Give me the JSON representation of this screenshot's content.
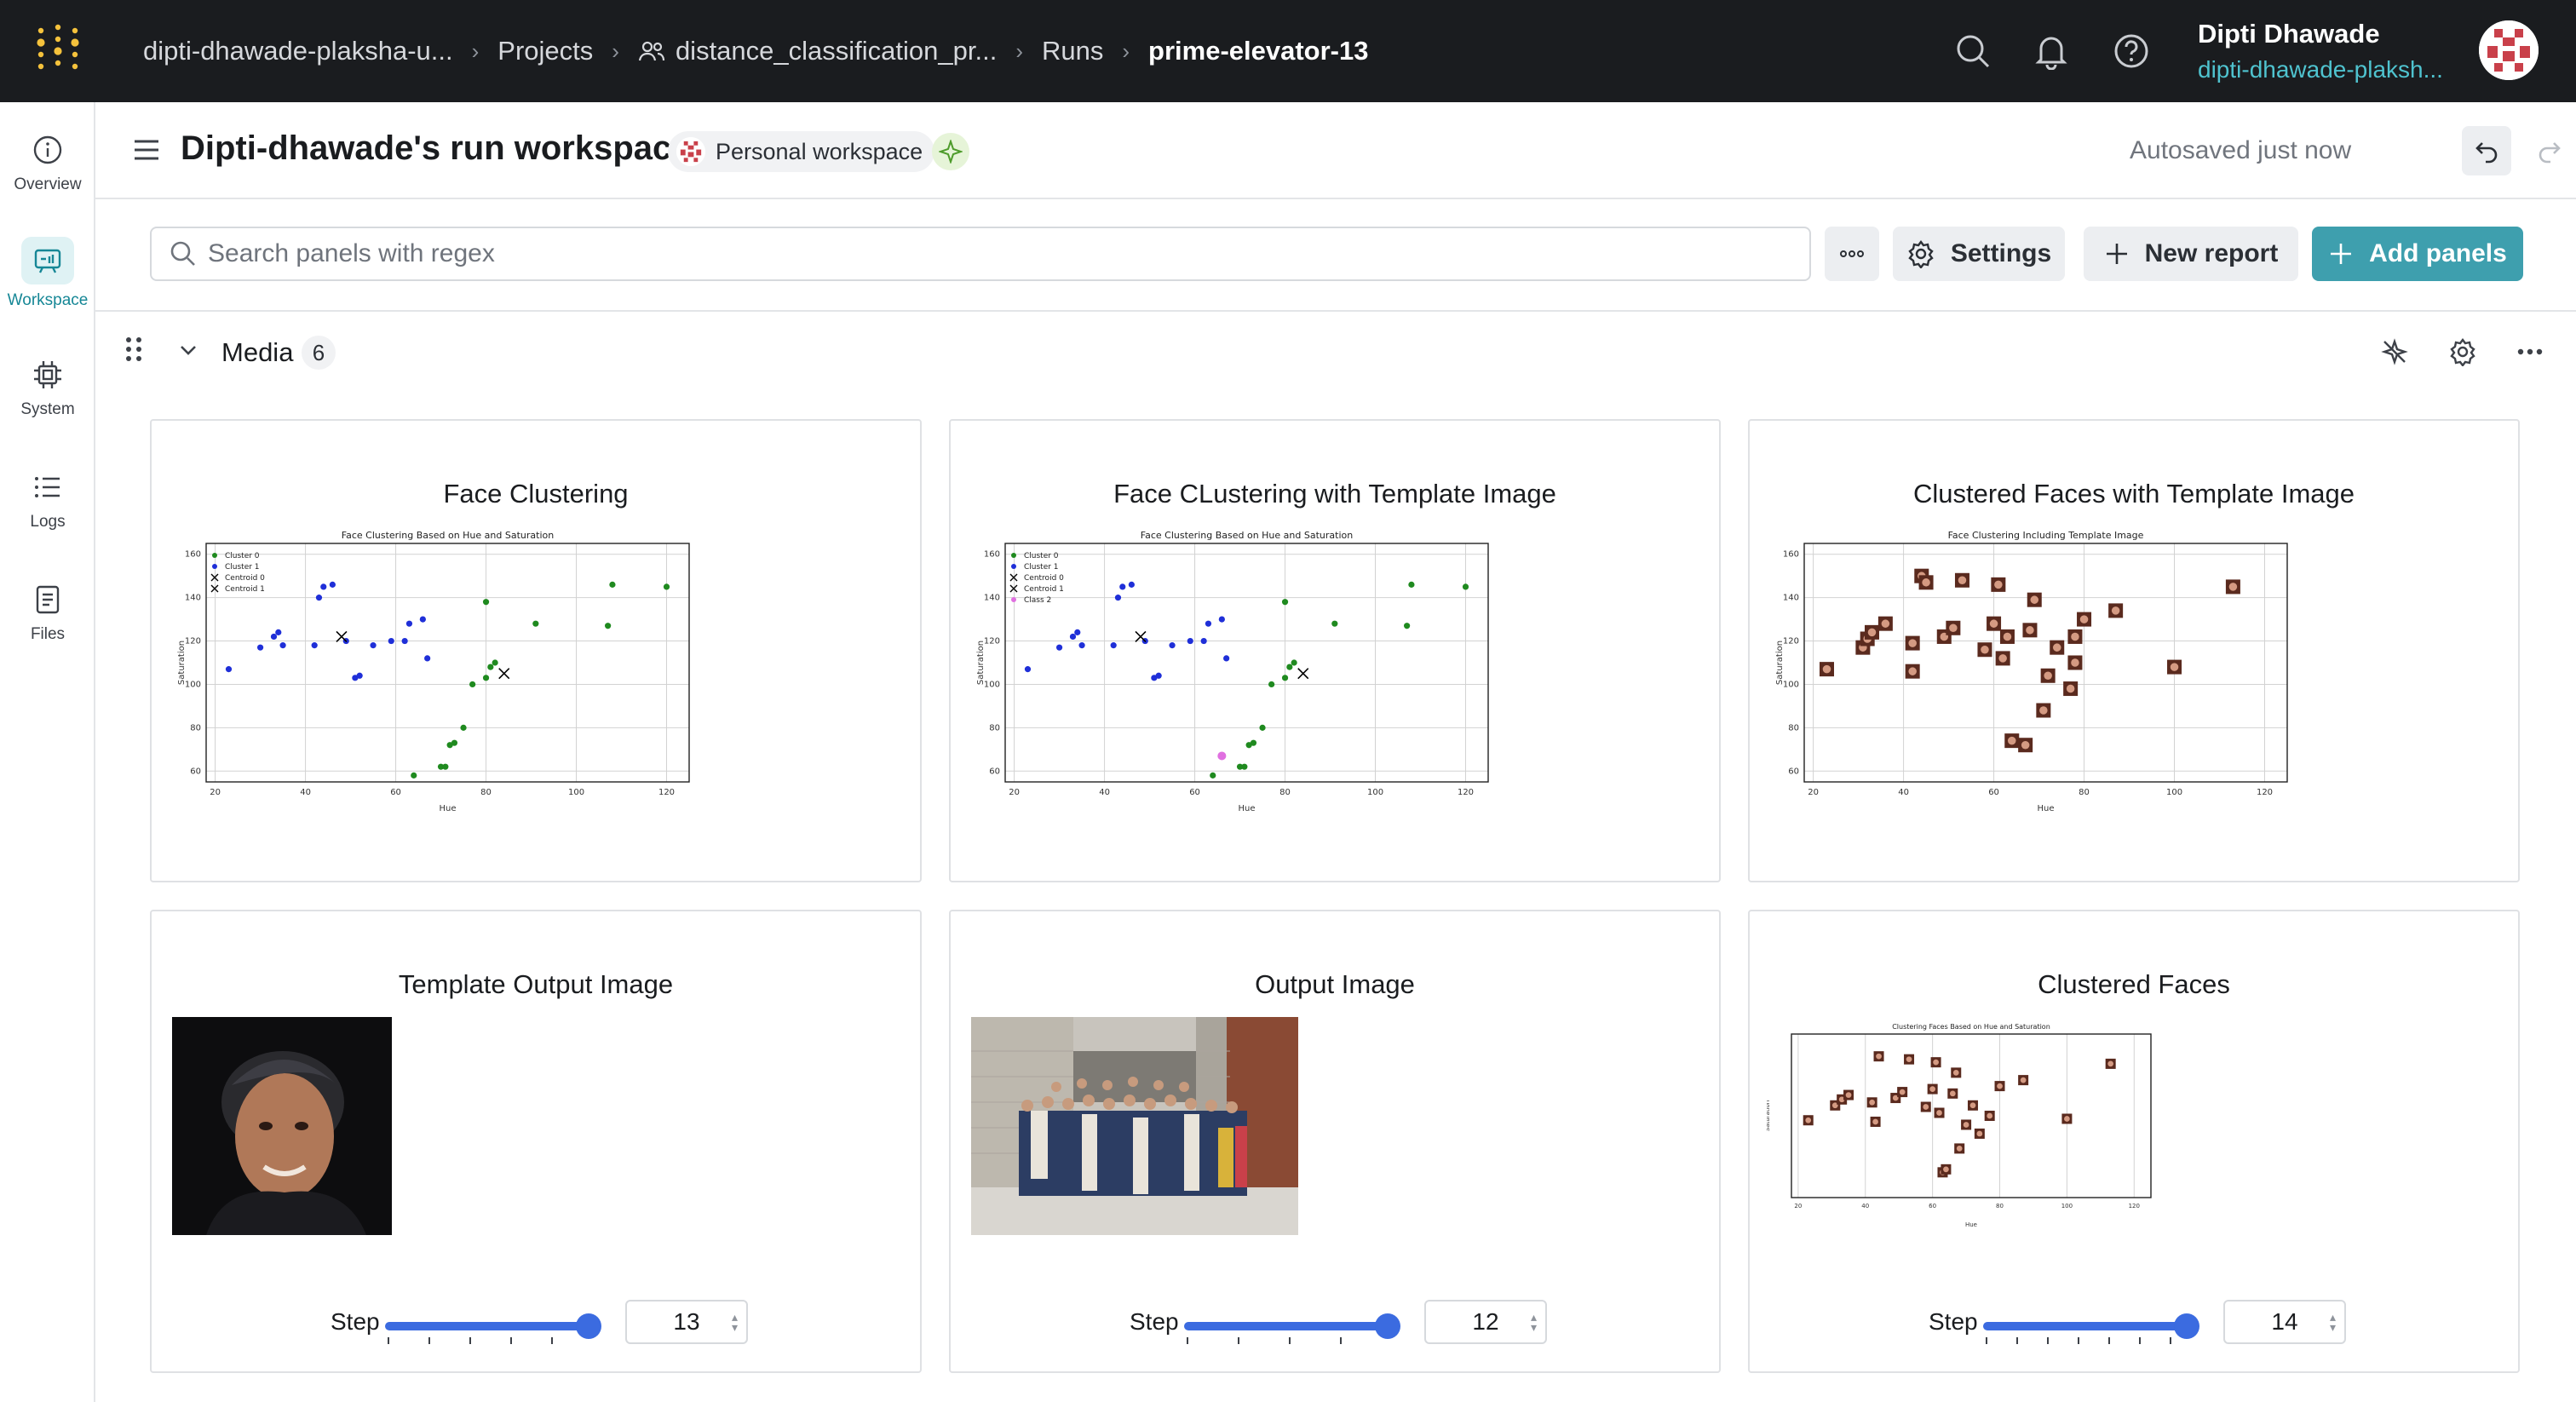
{
  "topbar": {
    "breadcrumbs": [
      "dipti-dhawade-plaksha-u...",
      "Projects",
      "distance_classification_pr...",
      "Runs",
      "prime-elevator-13"
    ],
    "user_name": "Dipti Dhawade",
    "user_org": "dipti-dhawade-plaksh..."
  },
  "leftnav": {
    "items": [
      {
        "label": "Overview",
        "icon": "info-icon"
      },
      {
        "label": "Workspace",
        "icon": "workspace-icon",
        "active": true
      },
      {
        "label": "System",
        "icon": "chip-icon"
      },
      {
        "label": "Logs",
        "icon": "list-icon"
      },
      {
        "label": "Files",
        "icon": "file-icon"
      }
    ]
  },
  "header": {
    "title": "Dipti-dhawade's run workspace",
    "workspace_badge": "Personal workspace",
    "autosaved": "Autosaved just now"
  },
  "toolbar": {
    "search_placeholder": "Search panels with regex",
    "settings_label": "Settings",
    "new_report_label": "New report",
    "add_panels_label": "Add panels"
  },
  "section": {
    "title": "Media",
    "count": "6"
  },
  "panels": [
    {
      "title": "Face Clustering",
      "chart_title": "Face Clustering Based on Hue and Saturation"
    },
    {
      "title": "Face CLustering with Template Image",
      "chart_title": "Face Clustering Based on Hue and Saturation"
    },
    {
      "title": "Clustered Faces with Template Image",
      "chart_title": "Face Clustering Including Template Image"
    },
    {
      "title": "Template Output Image",
      "step_label": "Step",
      "step_value": "13"
    },
    {
      "title": "Output Image",
      "step_label": "Step",
      "step_value": "12"
    },
    {
      "title": "Clustered Faces",
      "step_label": "Step",
      "step_value": "14",
      "chart_title": "Clustering Faces Based on Hue and Saturation"
    }
  ],
  "chart_data": [
    {
      "type": "scatter",
      "title": "Face Clustering Based on Hue and Saturation",
      "xlabel": "Hue",
      "ylabel": "Saturation",
      "xlim": [
        18,
        125
      ],
      "ylim": [
        55,
        165
      ],
      "xticks": [
        "20",
        "40",
        "60",
        "80",
        "100",
        "120"
      ],
      "yticks": [
        "60",
        "80",
        "100",
        "120",
        "140",
        "160"
      ],
      "legend": [
        "Cluster 0",
        "Cluster 1",
        "Centroid 0",
        "Centroid 1"
      ],
      "series": [
        {
          "name": "Cluster 0",
          "color": "#1f8a1f",
          "x": [
            64,
            70,
            71,
            72,
            73,
            75,
            77,
            80,
            81,
            82,
            91,
            107,
            108,
            120,
            80
          ],
          "y": [
            58,
            62,
            62,
            72,
            73,
            80,
            100,
            103,
            108,
            110,
            128,
            127,
            146,
            145,
            138
          ]
        },
        {
          "name": "Cluster 1",
          "color": "#1f2fd8",
          "x": [
            23,
            30,
            33,
            34,
            35,
            42,
            43,
            44,
            49,
            51,
            52,
            55,
            59,
            62,
            63,
            66,
            46,
            67
          ],
          "y": [
            107,
            117,
            122,
            124,
            118,
            118,
            140,
            145,
            120,
            103,
            104,
            118,
            120,
            120,
            128,
            130,
            146,
            112
          ]
        },
        {
          "name": "Centroid 0",
          "color": "#000000",
          "x": [
            84
          ],
          "y": [
            105
          ]
        },
        {
          "name": "Centroid 1",
          "color": "#000000",
          "x": [
            48
          ],
          "y": [
            122
          ]
        }
      ]
    },
    {
      "type": "scatter",
      "title": "Face Clustering Based on Hue and Saturation",
      "xlabel": "Hue",
      "ylabel": "Saturation",
      "xlim": [
        18,
        125
      ],
      "ylim": [
        55,
        165
      ],
      "xticks": [
        "20",
        "40",
        "60",
        "80",
        "100",
        "120"
      ],
      "yticks": [
        "60",
        "80",
        "100",
        "120",
        "140",
        "160"
      ],
      "legend": [
        "Cluster 0",
        "Cluster 1",
        "Centroid 0",
        "Centroid 1",
        "Class 2"
      ],
      "series": [
        {
          "name": "Cluster 0",
          "color": "#1f8a1f",
          "x": [
            64,
            70,
            71,
            72,
            73,
            75,
            77,
            80,
            81,
            82,
            91,
            107,
            108,
            120,
            80
          ],
          "y": [
            58,
            62,
            62,
            72,
            73,
            80,
            100,
            103,
            108,
            110,
            128,
            127,
            146,
            145,
            138
          ]
        },
        {
          "name": "Cluster 1",
          "color": "#1f2fd8",
          "x": [
            23,
            30,
            33,
            34,
            35,
            42,
            43,
            44,
            49,
            51,
            52,
            55,
            59,
            62,
            63,
            66,
            46,
            67
          ],
          "y": [
            107,
            117,
            122,
            124,
            118,
            118,
            140,
            145,
            120,
            103,
            104,
            118,
            120,
            120,
            128,
            130,
            146,
            112
          ]
        },
        {
          "name": "Centroid 0",
          "color": "#000000",
          "x": [
            84
          ],
          "y": [
            105
          ]
        },
        {
          "name": "Centroid 1",
          "color": "#000000",
          "x": [
            48
          ],
          "y": [
            122
          ]
        },
        {
          "name": "Class 2",
          "color": "#e070e0",
          "x": [
            66
          ],
          "y": [
            67
          ]
        }
      ]
    },
    {
      "type": "scatter",
      "title": "Face Clustering Including Template Image",
      "xlabel": "Hue",
      "ylabel": "Saturation",
      "xlim": [
        18,
        125
      ],
      "ylim": [
        55,
        165
      ],
      "xticks": [
        "20",
        "40",
        "60",
        "80",
        "100",
        "120"
      ],
      "yticks": [
        "60",
        "80",
        "100",
        "120",
        "140",
        "160"
      ],
      "series": [
        {
          "name": "faces",
          "color": "#7a3b2a",
          "x": [
            23,
            31,
            32,
            33,
            36,
            42,
            42,
            44,
            45,
            49,
            51,
            53,
            58,
            60,
            61,
            63,
            62,
            64,
            67,
            68,
            69,
            71,
            72,
            74,
            77,
            78,
            78,
            80,
            87,
            100,
            113
          ],
          "y": [
            107,
            117,
            121,
            124,
            128,
            119,
            106,
            150,
            147,
            122,
            126,
            148,
            116,
            128,
            146,
            122,
            112,
            74,
            72,
            125,
            139,
            88,
            104,
            117,
            98,
            110,
            122,
            130,
            134,
            108,
            145
          ]
        }
      ]
    },
    {
      "type": "scatter",
      "title": "Clustering Faces Based on Hue and Saturation",
      "xlabel": "Hue",
      "ylabel": "Saturation",
      "xlim": [
        18,
        125
      ],
      "ylim": [
        55,
        165
      ],
      "xticks": [
        "20",
        "40",
        "60",
        "80",
        "100",
        "120"
      ],
      "series": [
        {
          "name": "faces",
          "color": "#7a3b2a",
          "x": [
            23,
            31,
            33,
            35,
            42,
            43,
            44,
            49,
            51,
            53,
            58,
            60,
            61,
            62,
            63,
            64,
            66,
            67,
            68,
            70,
            72,
            74,
            77,
            80,
            87,
            100,
            113
          ],
          "y": [
            107,
            117,
            121,
            124,
            119,
            106,
            150,
            122,
            126,
            148,
            116,
            128,
            146,
            112,
            72,
            74,
            125,
            139,
            88,
            104,
            117,
            98,
            110,
            130,
            134,
            108,
            145
          ]
        }
      ]
    }
  ]
}
